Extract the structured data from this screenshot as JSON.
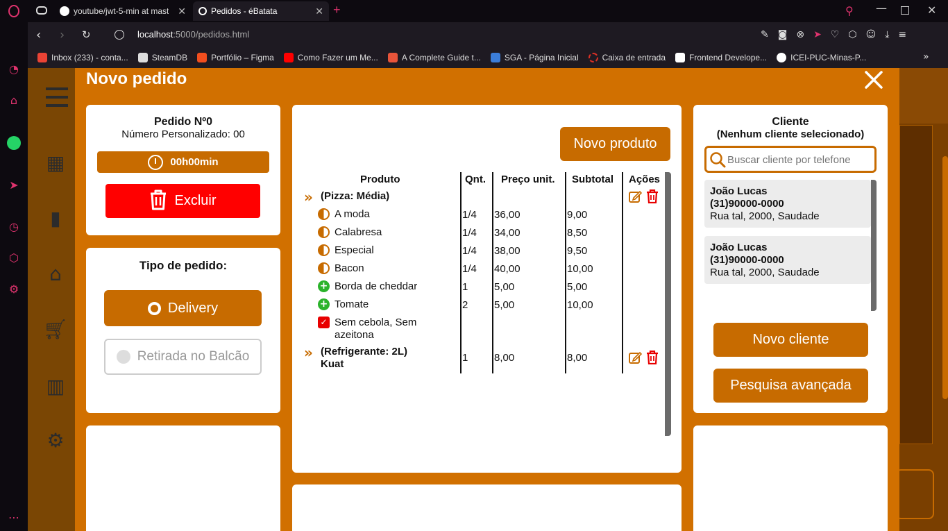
{
  "browser": {
    "tabs": [
      {
        "title": "youtube/jwt-5-min at mast"
      },
      {
        "title": "Pedidos - éBatata"
      }
    ],
    "url_host": "localhost",
    "url_rest": ":5000/pedidos.html",
    "bookmarks": [
      {
        "label": "Inbox (233) - conta...",
        "color": "#ea4335"
      },
      {
        "label": "SteamDB",
        "color": "#dddddd"
      },
      {
        "label": "Portfólio – Figma",
        "color": "#f24e1e"
      },
      {
        "label": "Como Fazer um Me...",
        "color": "#ff0000"
      },
      {
        "label": "A Complete Guide t...",
        "color": "#e8543a"
      },
      {
        "label": "SGA - Página Inicial",
        "color": "#3b7dd8"
      },
      {
        "label": "Caixa de entrada",
        "color": "#d93025"
      },
      {
        "label": "Frontend Develope...",
        "color": "#ffffff"
      },
      {
        "label": "ICEI-PUC-Minas-P...",
        "color": "#ffffff"
      }
    ]
  },
  "modal": {
    "title": "Novo pedido",
    "close_icon": "close-icon"
  },
  "pedido": {
    "title": "Pedido Nº0",
    "custom_number": "Número Personalizado: 00",
    "timer": "00h00min",
    "delete_label": "Excluir"
  },
  "tipo": {
    "title": "Tipo de pedido:",
    "delivery": "Delivery",
    "retirada": "Retirada no Balcão"
  },
  "produtos": {
    "new_button": "Novo produto",
    "headers": [
      "Produto",
      "Qnt.",
      "Preço unit.",
      "Subtotal",
      "Ações"
    ],
    "items": [
      {
        "name": "(Pizza: Média)",
        "qty": "",
        "price": "",
        "subtotal": ""
      },
      {
        "name": "A moda",
        "qty": "1/4",
        "price": "36,00",
        "subtotal": "9,00"
      },
      {
        "name": "Calabresa",
        "qty": "1/4",
        "price": "34,00",
        "subtotal": "8,50"
      },
      {
        "name": "Especial",
        "qty": "1/4",
        "price": "38,00",
        "subtotal": "9,50"
      },
      {
        "name": "Bacon",
        "qty": "1/4",
        "price": "40,00",
        "subtotal": "10,00"
      },
      {
        "name": "Borda de cheddar",
        "qty": "1",
        "price": "5,00",
        "subtotal": "5,00"
      },
      {
        "name": "Tomate",
        "qty": "2",
        "price": "5,00",
        "subtotal": "10,00"
      },
      {
        "name": "Sem cebola, Sem",
        "qty": "",
        "price": "",
        "subtotal": ""
      },
      {
        "name": "azeitona",
        "qty": "",
        "price": "",
        "subtotal": ""
      },
      {
        "name": "(Refrigerante: 2L)",
        "qty": "1",
        "price": "8,00",
        "subtotal": "8,00"
      },
      {
        "name": "Kuat",
        "qty": "",
        "price": "",
        "subtotal": ""
      }
    ]
  },
  "cliente": {
    "title": "Cliente",
    "subtitle": "(Nenhum cliente selecionado)",
    "search_placeholder": "Buscar cliente por telefone",
    "list": [
      {
        "name": "João Lucas",
        "phone": "(31)90000-0000",
        "address": "Rua tal, 2000, Saudade"
      },
      {
        "name": "João Lucas",
        "phone": "(31)90000-0000",
        "address": "Rua tal, 2000, Saudade"
      }
    ],
    "new_button": "Novo cliente",
    "search_button": "Pesquisa avançada"
  }
}
